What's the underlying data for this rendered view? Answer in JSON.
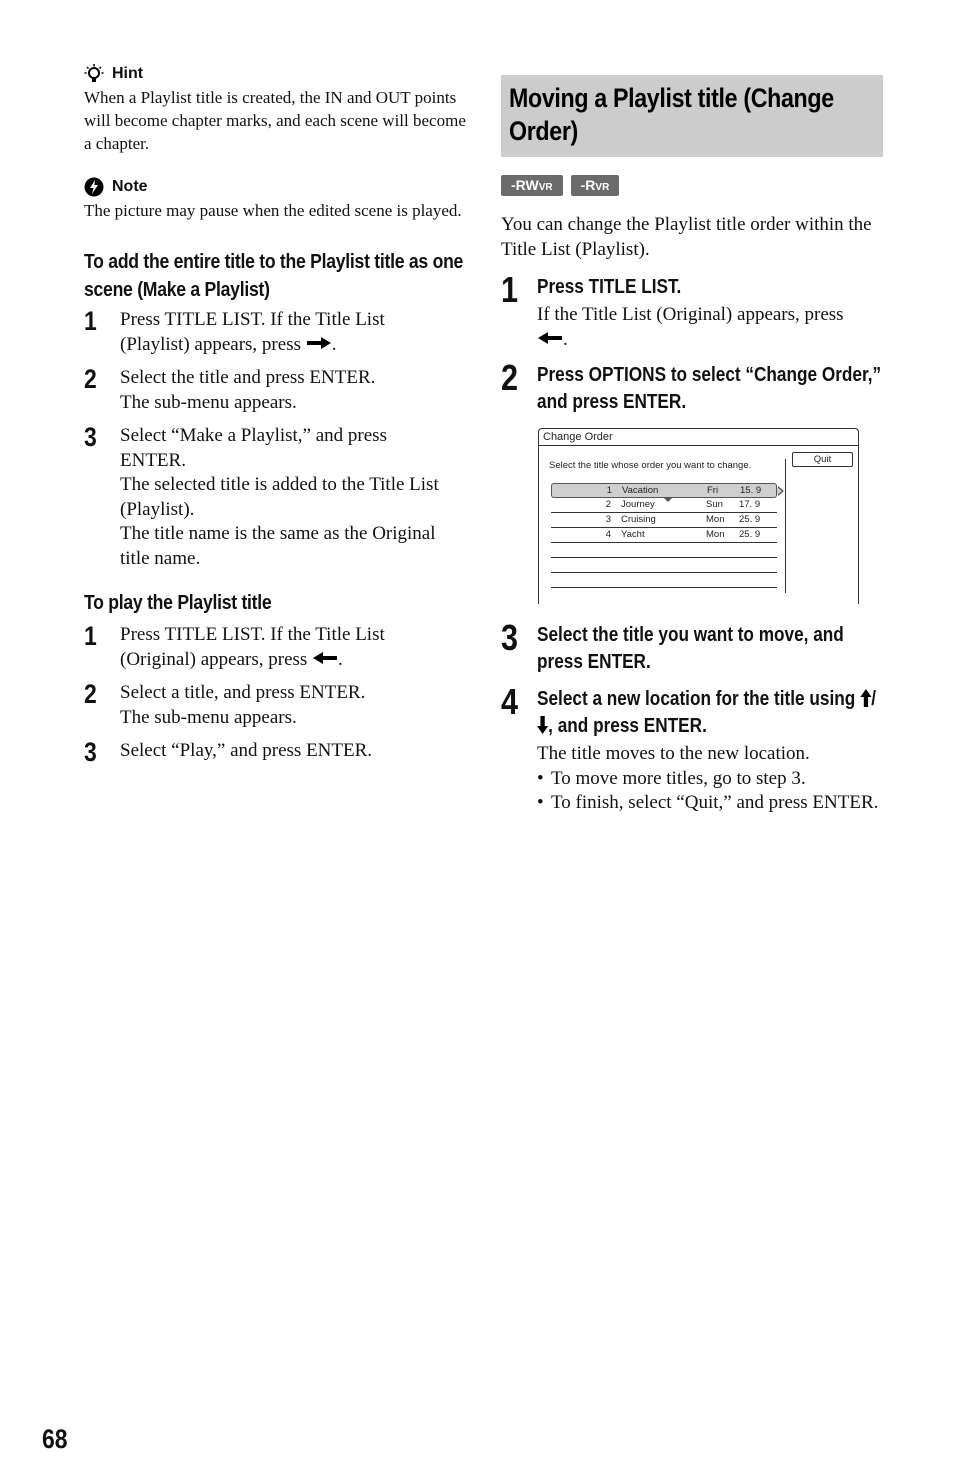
{
  "left": {
    "hint": {
      "label": "Hint",
      "icon": "lightbulb-icon",
      "text": "When a Playlist title is created, the IN and OUT points will become chapter marks, and each scene will become a chapter."
    },
    "note": {
      "label": "Note",
      "icon": "lightning-note-icon",
      "text": "The picture may pause when the edited scene is played."
    },
    "make_playlist": {
      "heading": "To add the entire title to the Playlist title as one scene (Make a Playlist)",
      "steps": [
        {
          "num": "1",
          "lines": [
            "Press TITLE LIST. If the Title List",
            "(Playlist) appears, press"
          ],
          "arrow": "right-arrow-icon",
          "after_arrow": "."
        },
        {
          "num": "2",
          "lines": [
            "Select the title and press ENTER.",
            "The sub-menu appears."
          ]
        },
        {
          "num": "3",
          "lines": [
            "Select “Make a Playlist,” and press",
            "ENTER.",
            "The selected title is added to the Title List",
            "(Playlist).",
            "The title name is the same as the Original",
            "title name."
          ]
        }
      ]
    },
    "play_playlist": {
      "heading": "To play the Playlist title",
      "steps": [
        {
          "num": "1",
          "lines": [
            "Press TITLE LIST. If the Title List",
            "(Original) appears, press"
          ],
          "arrow": "left-arrow-icon",
          "after_arrow": "."
        },
        {
          "num": "2",
          "lines": [
            "Select a title, and press ENTER.",
            "The sub-menu appears."
          ]
        },
        {
          "num": "3",
          "lines": [
            "Select “Play,” and press ENTER."
          ]
        }
      ]
    }
  },
  "right": {
    "section_title": "Moving a Playlist title (Change Order)",
    "badges": [
      {
        "main": "-RW",
        "sub": "VR"
      },
      {
        "main": "-R",
        "sub": "VR"
      }
    ],
    "intro": "You can change the Playlist title order within the Title List (Playlist).",
    "steps": [
      {
        "num": "1",
        "title": "Press TITLE LIST.",
        "body": "If the Title List (Original) appears, press",
        "arrow": "left-arrow-icon",
        "after_arrow": "."
      },
      {
        "num": "2",
        "title": "Press OPTIONS to select “Change Order,” and press ENTER."
      },
      {
        "num": "3",
        "title": "Select the title you want to move, and press ENTER."
      },
      {
        "num": "4",
        "title_pre": "Select a new location for the title using ",
        "title_post": ", and press ENTER.",
        "body": "The title moves to the new location.",
        "bullets": [
          "To move more titles, go to step 3.",
          "To finish, select “Quit,” and press ENTER."
        ]
      }
    ],
    "screen": {
      "window_title": "Change Order",
      "instruction": "Select the title whose order you want to change.",
      "quit_label": "Quit",
      "rows": [
        {
          "num": "1",
          "name": "Vacation",
          "day": "Fri",
          "date": "15. 9",
          "selected": true
        },
        {
          "num": "2",
          "name": "Journey",
          "day": "Sun",
          "date": "17. 9"
        },
        {
          "num": "3",
          "name": "Cruising",
          "day": "Mon",
          "date": "25. 9"
        },
        {
          "num": "4",
          "name": "Yacht",
          "day": "Mon",
          "date": "25. 9"
        }
      ],
      "empty_rows": 3
    }
  },
  "page_number": "68"
}
